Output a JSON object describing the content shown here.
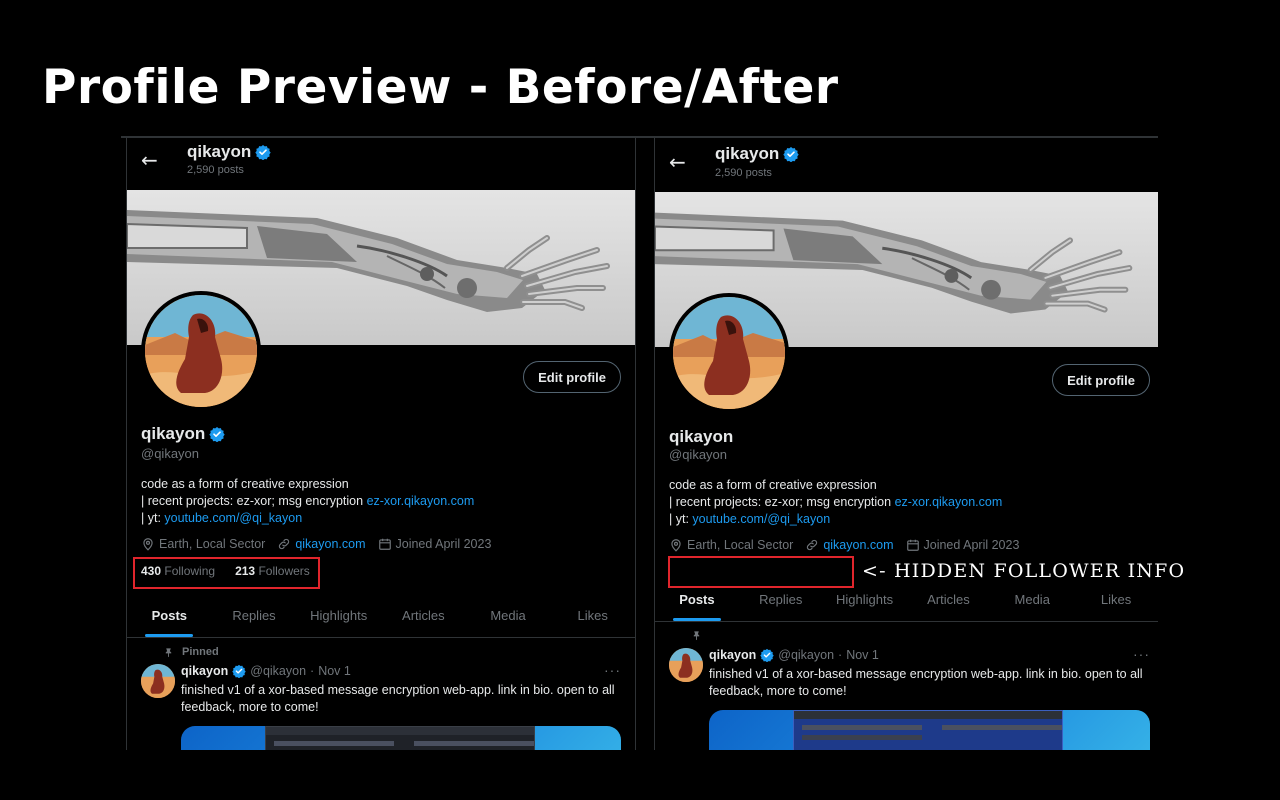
{
  "slide_title": "Profile Preview - Before/After",
  "colors": {
    "accent": "#1d9bf0",
    "highlight_box": "#e0252c",
    "background": "#000000",
    "muted_text": "#71767b"
  },
  "icons": {
    "back": "back-arrow-icon",
    "verified": "verified-badge-icon",
    "location": "location-pin-icon",
    "link": "link-icon",
    "calendar": "calendar-icon",
    "pin": "pin-icon",
    "more": "more-dots-icon"
  },
  "before": {
    "topbar": {
      "back_glyph": "←",
      "name": "qikayon",
      "posts": "2,590 posts"
    },
    "edit_profile": "Edit profile",
    "display_name": "qikayon",
    "handle": "@qikayon",
    "bio": {
      "line1": "code as a form of creative expression",
      "line2_text": "| recent projects: ez-xor; msg encryption ",
      "line2_link": "ez-xor.qikayon.com",
      "line3_text": "| yt: ",
      "line3_link": "youtube.com/@qi_kayon"
    },
    "meta": {
      "location": "Earth, Local Sector",
      "website": "qikayon.com",
      "joined": "Joined April 2023"
    },
    "follow": {
      "following_count": "430",
      "following_label": "Following",
      "followers_count": "213",
      "followers_label": "Followers"
    },
    "tabs": [
      "Posts",
      "Replies",
      "Highlights",
      "Articles",
      "Media",
      "Likes"
    ],
    "pinned_label": "Pinned",
    "post": {
      "name": "qikayon",
      "handle": "@qikayon",
      "dot": "·",
      "date": "Nov 1",
      "more": "···",
      "text": "finished v1 of a xor-based message encryption web-app. link in bio. open to all feedback, more to come!"
    }
  },
  "after": {
    "topbar": {
      "back_glyph": "←",
      "name": "qikayon",
      "posts": "2,590 posts"
    },
    "edit_profile": "Edit profile",
    "display_name": "qikayon",
    "handle": "@qikayon",
    "bio": {
      "line1": "code as a form of creative expression",
      "line2_text": "| recent projects: ez-xor; msg encryption ",
      "line2_link": "ez-xor.qikayon.com",
      "line3_text": "| yt: ",
      "line3_link": "youtube.com/@qi_kayon"
    },
    "meta": {
      "location": "Earth, Local Sector",
      "website": "qikayon.com",
      "joined": "Joined April 2023"
    },
    "hidden_note": "<- HIDDEN FOLLOWER INFO",
    "tabs": [
      "Posts",
      "Replies",
      "Highlights",
      "Articles",
      "Media",
      "Likes"
    ],
    "post": {
      "name": "qikayon",
      "handle": "@qikayon",
      "dot": "·",
      "date": "Nov 1",
      "more": "···",
      "text": "finished v1 of a xor-based message encryption web-app. link in bio. open to all feedback, more to come!"
    }
  }
}
